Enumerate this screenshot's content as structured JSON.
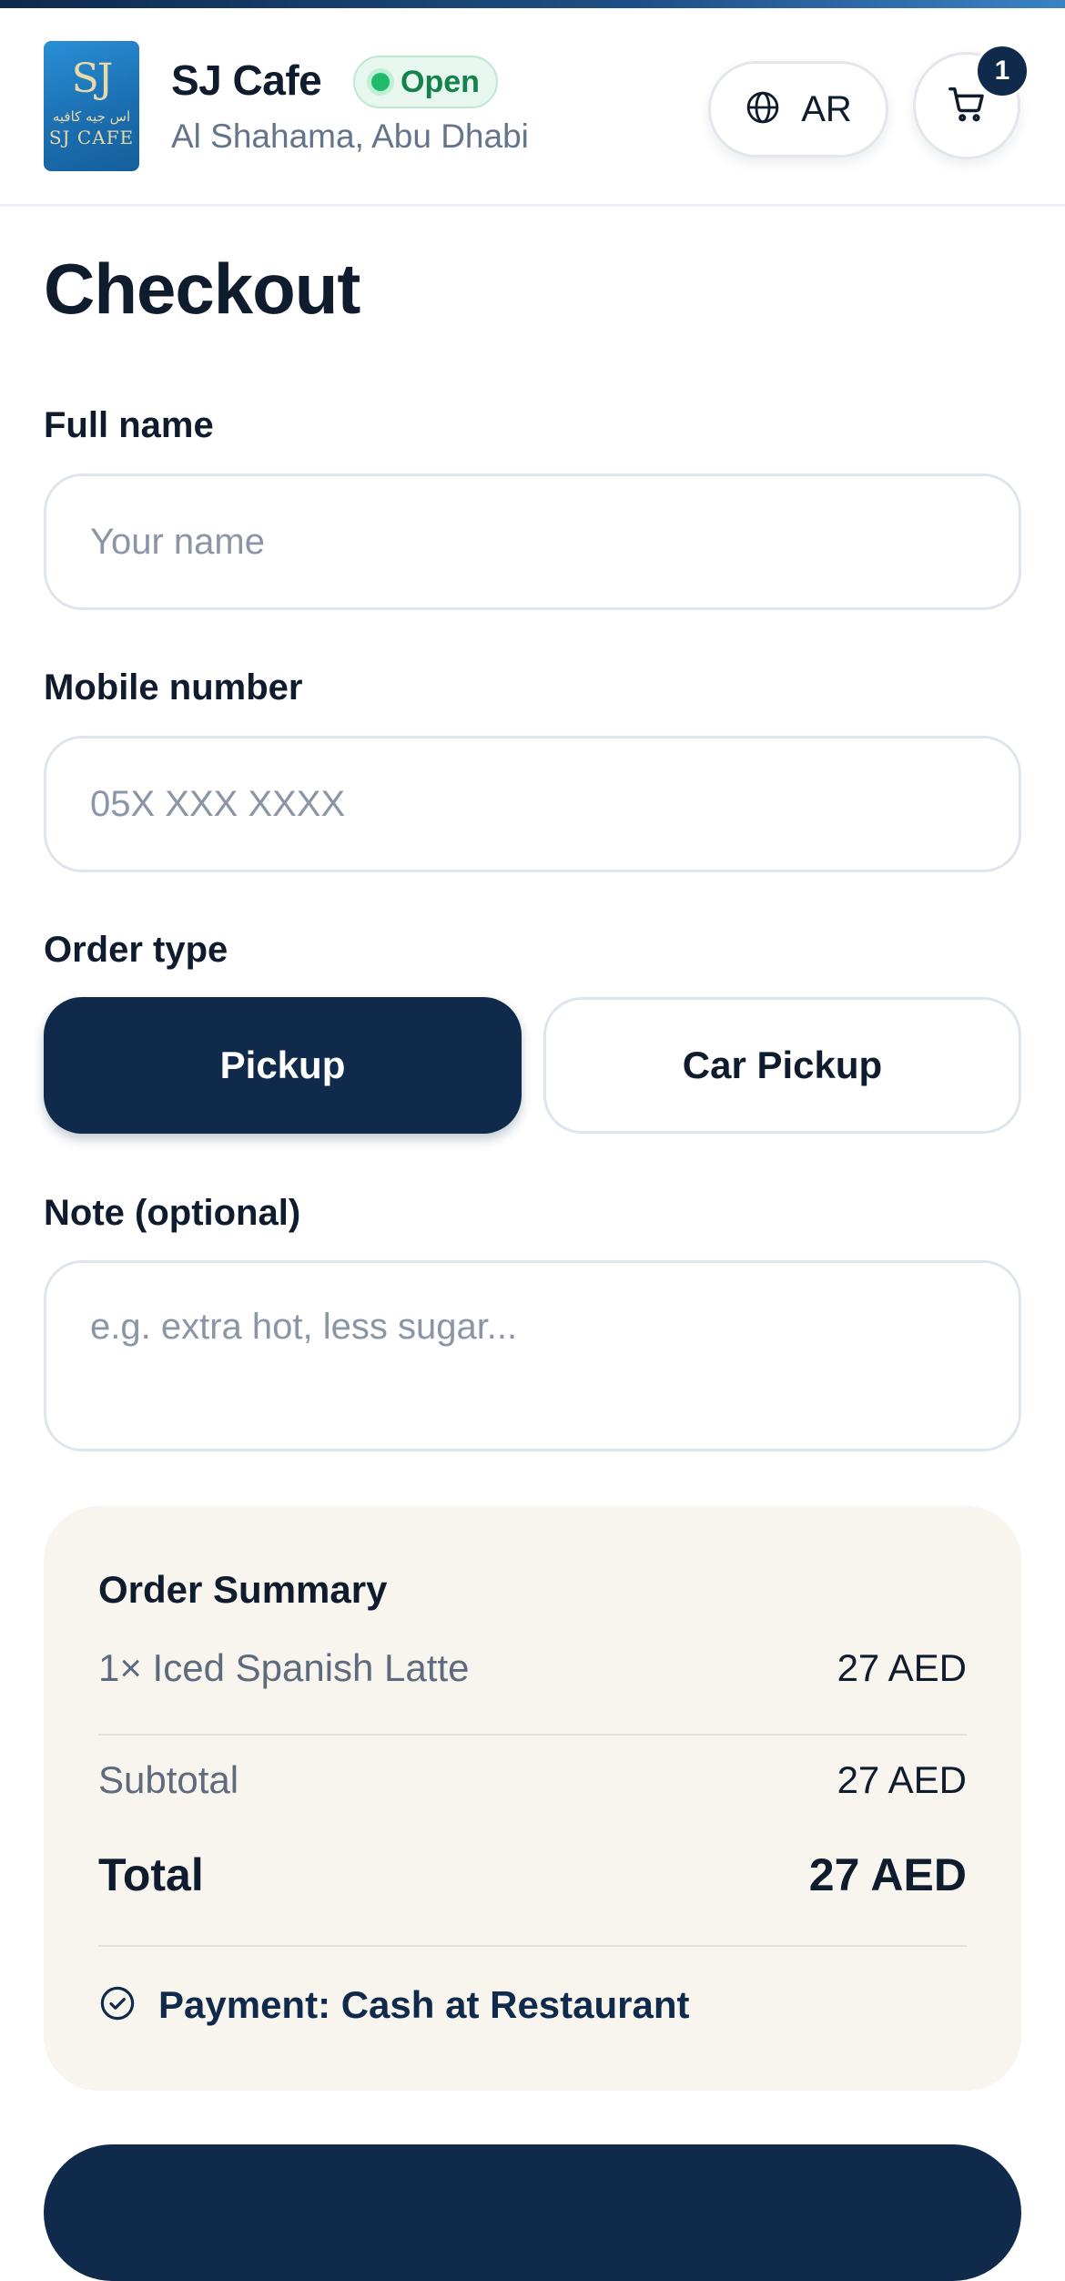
{
  "header": {
    "logo_monogram": "SJ",
    "logo_arabic": "اس جيه كافيه",
    "logo_english": "SJ CAFE",
    "cafe_name": "SJ Cafe",
    "status": "Open",
    "location": "Al Shahama, Abu Dhabi",
    "language_button": "AR",
    "cart_count": "1"
  },
  "checkout": {
    "title": "Checkout",
    "full_name": {
      "label": "Full name",
      "placeholder": "Your name",
      "value": ""
    },
    "mobile": {
      "label": "Mobile number",
      "placeholder": "05X XXX XXXX",
      "value": ""
    },
    "order_type": {
      "label": "Order type",
      "options": [
        "Pickup",
        "Car Pickup"
      ],
      "selected": "Pickup"
    },
    "note": {
      "label": "Note (optional)",
      "placeholder": "e.g. extra hot, less sugar...",
      "value": ""
    }
  },
  "summary": {
    "title": "Order Summary",
    "items": [
      {
        "label": "1× Iced Spanish Latte",
        "price": "27 AED"
      }
    ],
    "subtotal_label": "Subtotal",
    "subtotal_value": "27 AED",
    "total_label": "Total",
    "total_value": "27 AED",
    "payment": "Payment: Cash at Restaurant"
  },
  "colors": {
    "primary": "#0f2a4a",
    "open_green": "#1fba6a",
    "summary_bg": "#f8f4ee",
    "muted_text": "#64748b"
  },
  "icons": {
    "language": "globe-icon",
    "cart": "cart-icon",
    "payment": "check-circle-icon"
  }
}
